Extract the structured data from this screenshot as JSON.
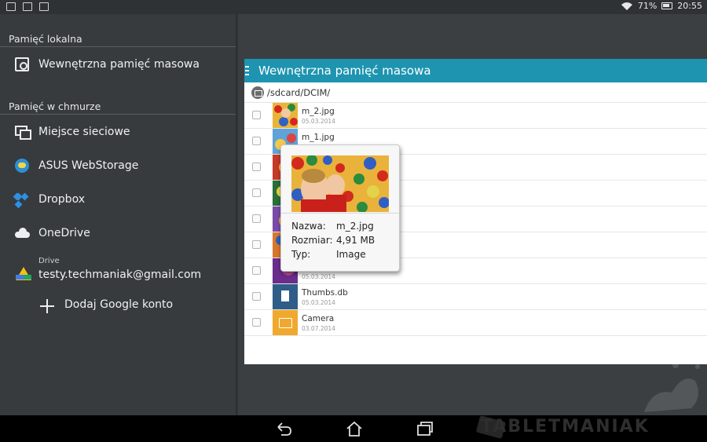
{
  "status_bar": {
    "battery": "71%",
    "time": "20:55",
    "notification_icons": [
      "keyboard-icon",
      "download-icon",
      "image-icon"
    ]
  },
  "drawer": {
    "local_header": "Pamięć lokalna",
    "internal_storage": "Wewnętrzna pamięć masowa",
    "cloud_header": "Pamięć w chmurze",
    "items": [
      {
        "label": "Miejsce sieciowe",
        "icon": "network-icon"
      },
      {
        "label": "ASUS WebStorage",
        "icon": "asus-webstorage-icon"
      },
      {
        "label": "Dropbox",
        "icon": "dropbox-icon"
      },
      {
        "label": "OneDrive",
        "icon": "onedrive-icon"
      }
    ],
    "drive": {
      "label": "Drive",
      "email": "testy.techmaniak@gmail.com"
    },
    "add_account": "Dodaj Google konto"
  },
  "panel": {
    "title": "Wewnętrzna pamięć masowa",
    "path": "/sdcard/DCIM/",
    "files": [
      {
        "name": "m_2.jpg",
        "date": "05.03.2014"
      },
      {
        "name": "m_1.jpg",
        "date": ""
      },
      {
        "name": "",
        "date": ""
      },
      {
        "name": "",
        "date": ""
      },
      {
        "name": "",
        "date": ""
      },
      {
        "name": "",
        "date": ""
      },
      {
        "name": "",
        "date": "05.03.2014"
      },
      {
        "name": "Thumbs.db",
        "date": "05.03.2014"
      },
      {
        "name": "Camera",
        "date": "03.07.2014"
      }
    ]
  },
  "popup": {
    "name_label": "Nazwa:",
    "name_value": "m_2.jpg",
    "size_label": "Rozmiar:",
    "size_value": "4,91 MB",
    "type_label": "Typ:",
    "type_value": "Image"
  },
  "watermark": "TABLETMANIAK",
  "colors": {
    "accent": "#1e94b0",
    "drawer_bg": "#373b3e",
    "background": "#3b3f42"
  }
}
